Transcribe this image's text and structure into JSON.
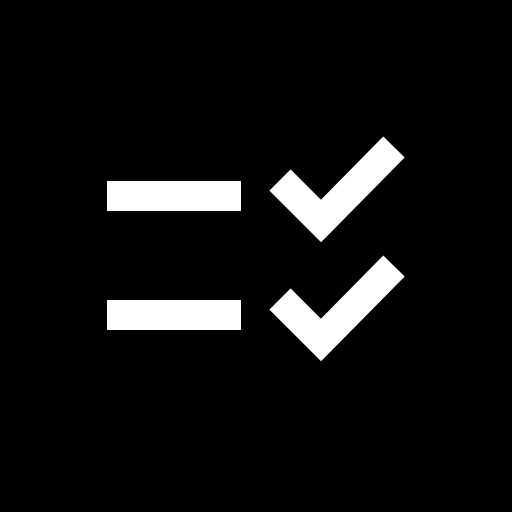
{
  "icon": {
    "name": "checklist-icon",
    "background_color": "#000000",
    "foreground_color": "#ffffff",
    "rows": [
      {
        "line_name": "list-line",
        "check_name": "check-icon",
        "checked": true
      },
      {
        "line_name": "list-line",
        "check_name": "check-icon",
        "checked": true
      }
    ]
  }
}
